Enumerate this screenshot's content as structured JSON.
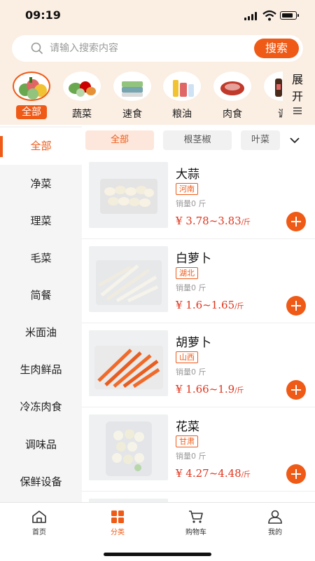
{
  "status": {
    "time": "09:19"
  },
  "search": {
    "placeholder": "请输入搜索内容",
    "button": "搜索"
  },
  "categories": [
    {
      "label": "全部",
      "icon": "mixed-vegetables-icon",
      "active": true
    },
    {
      "label": "蔬菜",
      "icon": "vegetables-icon"
    },
    {
      "label": "速食",
      "icon": "fast-food-icon"
    },
    {
      "label": "粮油",
      "icon": "grain-oil-icon"
    },
    {
      "label": "肉食",
      "icon": "meat-icon"
    },
    {
      "label": "调",
      "icon": "seasoning-icon"
    }
  ],
  "expand_label": "展开",
  "sidebar": {
    "items": [
      {
        "label": "全部",
        "active": true
      },
      {
        "label": "净菜"
      },
      {
        "label": "理菜"
      },
      {
        "label": "毛菜"
      },
      {
        "label": "简餐"
      },
      {
        "label": "米面油"
      },
      {
        "label": "生肉鲜品"
      },
      {
        "label": "冷冻肉食"
      },
      {
        "label": "调味品"
      },
      {
        "label": "保鲜设备"
      }
    ]
  },
  "subtabs": [
    {
      "label": "全部",
      "active": true
    },
    {
      "label": "根茎椒"
    },
    {
      "label": "叶菜"
    }
  ],
  "products": [
    {
      "name": "大蒜",
      "origin": "河南",
      "sold": "销量0 斤",
      "price": "¥ 3.78~3.83",
      "unit": "/斤"
    },
    {
      "name": "白萝卜",
      "origin": "湖北",
      "sold": "销量0 斤",
      "price": "¥ 1.6~1.65",
      "unit": "/斤"
    },
    {
      "name": "胡萝卜",
      "origin": "山西",
      "sold": "销量0 斤",
      "price": "¥ 1.66~1.9",
      "unit": "/斤"
    },
    {
      "name": "花菜",
      "origin": "甘肃",
      "sold": "销量0 斤",
      "price": "¥ 4.27~4.48",
      "unit": "/斤"
    }
  ],
  "bottom_nav": [
    {
      "label": "首页",
      "icon": "home-icon"
    },
    {
      "label": "分类",
      "icon": "category-grid-icon",
      "active": true
    },
    {
      "label": "购物车",
      "icon": "cart-icon"
    },
    {
      "label": "我的",
      "icon": "user-icon"
    }
  ],
  "colors": {
    "accent": "#ef5a17",
    "price": "#e0341c",
    "header_bg": "#fbeee3"
  }
}
